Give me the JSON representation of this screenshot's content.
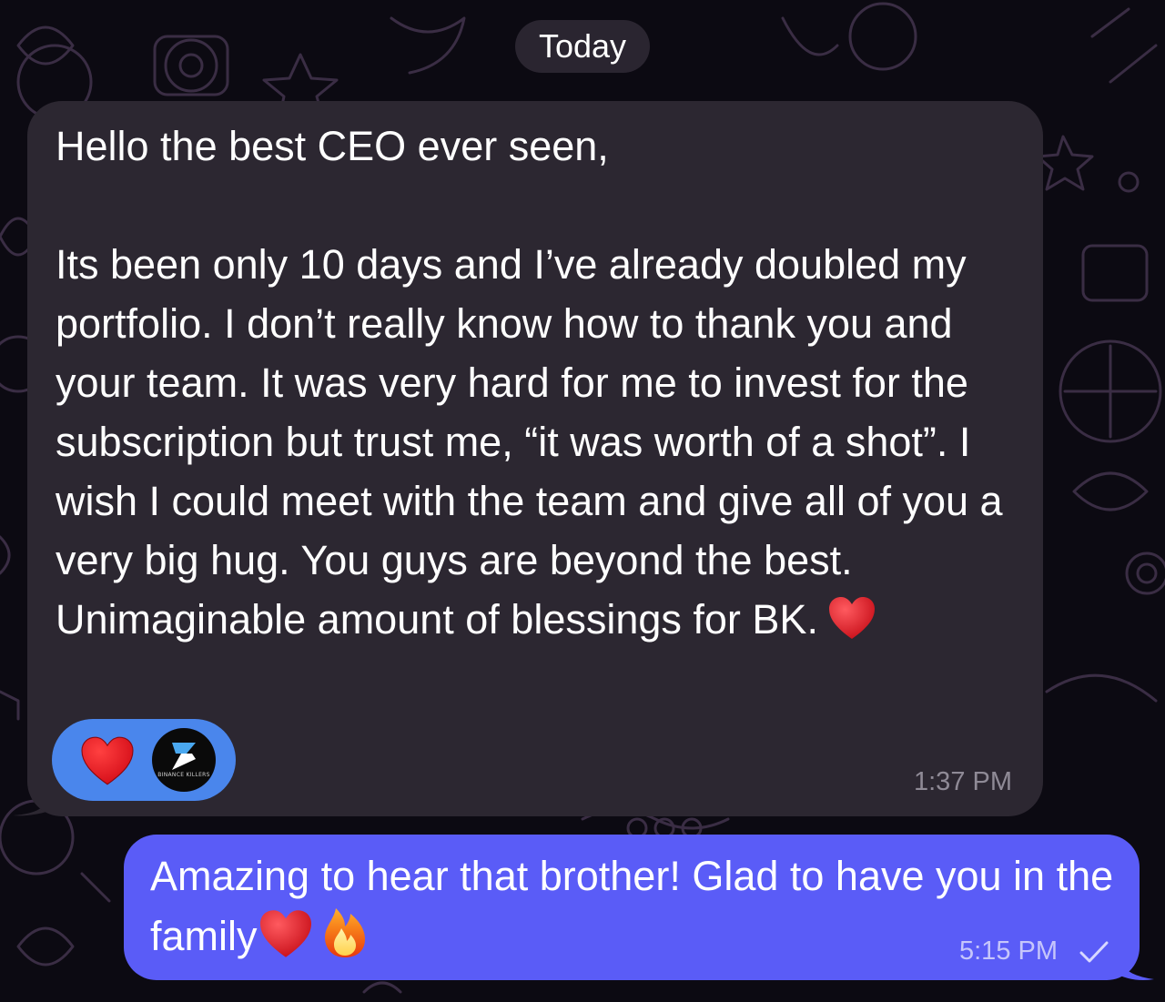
{
  "chat": {
    "date_separator": "Today",
    "incoming": {
      "text": "Hello the best CEO ever seen,\n\nIts been only 10 days and I’ve already doubled my portfolio. I don’t really know how to thank you and your team. It was very hard for me to invest for the subscription but trust me, “it was worth of a shot”. I wish I could meet with the team and give all of you a very big hug. You guys are beyond the best. Unimaginable amount of blessings for BK.",
      "trailing_emoji": "red-heart",
      "time": "1:37 PM",
      "reactions": [
        {
          "type": "emoji",
          "icon": "red-heart-icon"
        },
        {
          "type": "avatar",
          "icon": "lightning-logo-icon",
          "caption": "BINANCE KILLERS"
        }
      ]
    },
    "outgoing": {
      "text_part1": "Amazing to hear that brother! Glad to have you in the family",
      "emojis": [
        "red-heart",
        "fire"
      ],
      "time": "5:15 PM",
      "status_icon": "single-check-icon"
    }
  },
  "colors": {
    "background": "#0c0a12",
    "incoming_bubble": "#2c2731",
    "outgoing_bubble": "#5a5cf7",
    "reaction_pill": "#4a86ec",
    "heart": "#e8202c",
    "text": "#ffffff"
  }
}
